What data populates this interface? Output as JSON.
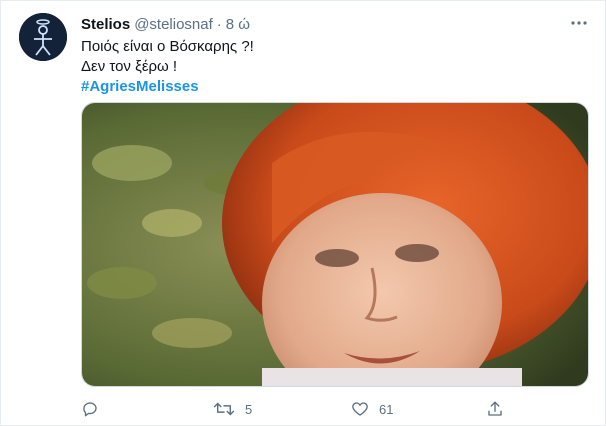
{
  "tweet": {
    "author_name": "Stelios",
    "author_handle": "@steliosnaf",
    "separator": "·",
    "time": "8 ώ",
    "line1": "Ποιός είναι ο Βόσκαρης ?!",
    "line2": "Δεν τον ξέρω !",
    "hashtag": "#AgriesMelisses"
  },
  "actions": {
    "reply_count": "",
    "retweet_count": "5",
    "like_count": "61",
    "share_count": ""
  },
  "icons": {
    "more": "more-icon",
    "reply": "reply-icon",
    "retweet": "retweet-icon",
    "like": "heart-icon",
    "share": "share-icon"
  },
  "colors": {
    "hashtag": "#1b95e0",
    "secondary_text": "#5b7083",
    "avatar_bg": "#132238"
  }
}
